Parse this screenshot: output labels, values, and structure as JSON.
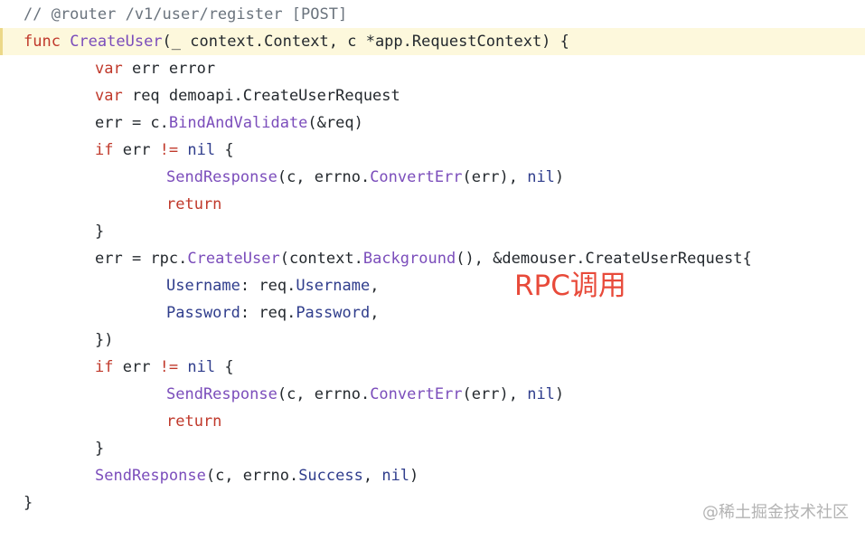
{
  "code": {
    "lines": [
      {
        "indent": 0,
        "highlight": false,
        "tokens": [
          {
            "t": "// @router /v1/user/register [POST]",
            "c": "comment"
          }
        ]
      },
      {
        "indent": 0,
        "highlight": true,
        "tokens": [
          {
            "t": "func ",
            "c": "kw"
          },
          {
            "t": "CreateUser",
            "c": "fn"
          },
          {
            "t": "(_ context.Context, c *app.RequestContext) {",
            "c": "plain"
          }
        ]
      },
      {
        "indent": 1,
        "highlight": false,
        "tokens": [
          {
            "t": "var ",
            "c": "kw"
          },
          {
            "t": "err error",
            "c": "plain"
          }
        ]
      },
      {
        "indent": 1,
        "highlight": false,
        "tokens": [
          {
            "t": "var ",
            "c": "kw"
          },
          {
            "t": "req demoapi.CreateUserRequest",
            "c": "plain"
          }
        ]
      },
      {
        "indent": 1,
        "highlight": false,
        "tokens": [
          {
            "t": "err = c.",
            "c": "plain"
          },
          {
            "t": "BindAndValidate",
            "c": "fn"
          },
          {
            "t": "(&req)",
            "c": "plain"
          }
        ]
      },
      {
        "indent": 1,
        "highlight": false,
        "tokens": [
          {
            "t": "if ",
            "c": "kw"
          },
          {
            "t": "err ",
            "c": "plain"
          },
          {
            "t": "!= ",
            "c": "kw"
          },
          {
            "t": "nil",
            "c": "id"
          },
          {
            "t": " {",
            "c": "plain"
          }
        ]
      },
      {
        "indent": 2,
        "highlight": false,
        "tokens": [
          {
            "t": "SendResponse",
            "c": "fn"
          },
          {
            "t": "(c, errno.",
            "c": "plain"
          },
          {
            "t": "ConvertErr",
            "c": "fn"
          },
          {
            "t": "(err), ",
            "c": "plain"
          },
          {
            "t": "nil",
            "c": "id"
          },
          {
            "t": ")",
            "c": "plain"
          }
        ]
      },
      {
        "indent": 2,
        "highlight": false,
        "tokens": [
          {
            "t": "return",
            "c": "kw"
          }
        ]
      },
      {
        "indent": 1,
        "highlight": false,
        "tokens": [
          {
            "t": "}",
            "c": "plain"
          }
        ]
      },
      {
        "indent": 1,
        "highlight": false,
        "tokens": [
          {
            "t": "err = rpc.",
            "c": "plain"
          },
          {
            "t": "CreateUser",
            "c": "fn"
          },
          {
            "t": "(context.",
            "c": "plain"
          },
          {
            "t": "Background",
            "c": "fn"
          },
          {
            "t": "(), &demouser.CreateUserRequest{",
            "c": "plain"
          }
        ]
      },
      {
        "indent": 2,
        "highlight": false,
        "tokens": [
          {
            "t": "Username",
            "c": "id"
          },
          {
            "t": ": req.",
            "c": "plain"
          },
          {
            "t": "Username",
            "c": "id"
          },
          {
            "t": ",",
            "c": "plain"
          }
        ]
      },
      {
        "indent": 2,
        "highlight": false,
        "tokens": [
          {
            "t": "Password",
            "c": "id"
          },
          {
            "t": ": req.",
            "c": "plain"
          },
          {
            "t": "Password",
            "c": "id"
          },
          {
            "t": ",",
            "c": "plain"
          }
        ]
      },
      {
        "indent": 1,
        "highlight": false,
        "tokens": [
          {
            "t": "})",
            "c": "plain"
          }
        ]
      },
      {
        "indent": 1,
        "highlight": false,
        "tokens": [
          {
            "t": "if ",
            "c": "kw"
          },
          {
            "t": "err ",
            "c": "plain"
          },
          {
            "t": "!= ",
            "c": "kw"
          },
          {
            "t": "nil",
            "c": "id"
          },
          {
            "t": " {",
            "c": "plain"
          }
        ]
      },
      {
        "indent": 2,
        "highlight": false,
        "tokens": [
          {
            "t": "SendResponse",
            "c": "fn"
          },
          {
            "t": "(c, errno.",
            "c": "plain"
          },
          {
            "t": "ConvertErr",
            "c": "fn"
          },
          {
            "t": "(err), ",
            "c": "plain"
          },
          {
            "t": "nil",
            "c": "id"
          },
          {
            "t": ")",
            "c": "plain"
          }
        ]
      },
      {
        "indent": 2,
        "highlight": false,
        "tokens": [
          {
            "t": "return",
            "c": "kw"
          }
        ]
      },
      {
        "indent": 1,
        "highlight": false,
        "tokens": [
          {
            "t": "}",
            "c": "plain"
          }
        ]
      },
      {
        "indent": 1,
        "highlight": false,
        "tokens": [
          {
            "t": "SendResponse",
            "c": "fn"
          },
          {
            "t": "(c, errno.",
            "c": "plain"
          },
          {
            "t": "Success",
            "c": "id"
          },
          {
            "t": ", ",
            "c": "plain"
          },
          {
            "t": "nil",
            "c": "id"
          },
          {
            "t": ")",
            "c": "plain"
          }
        ]
      },
      {
        "indent": 0,
        "highlight": false,
        "tokens": [
          {
            "t": "}",
            "c": "plain"
          }
        ]
      }
    ]
  },
  "annotation": {
    "text": "RPC调用"
  },
  "watermark": {
    "text": "@稀土掘金技术社区"
  },
  "colors": {
    "keyword": "#c0392b",
    "function": "#7b4dbb",
    "identifier": "#2f3d8c",
    "comment": "#6a737d",
    "annotation": "#e84a3a",
    "highlight_line_bg": "#fdf8dc"
  }
}
